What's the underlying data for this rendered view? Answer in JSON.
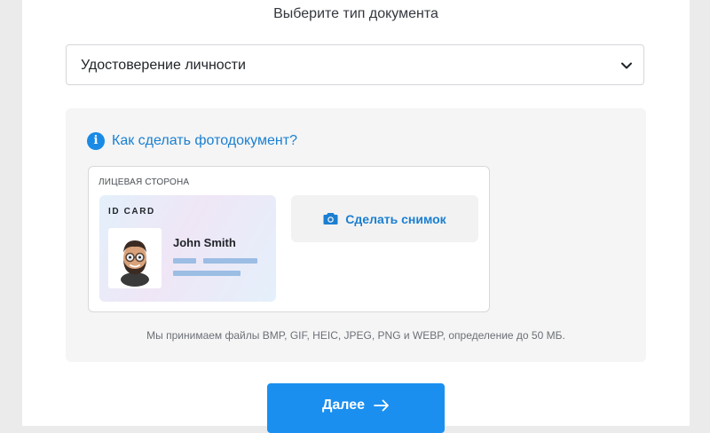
{
  "heading": "Выберите тип документа",
  "document_select": {
    "selected": "Удостоверение личности",
    "icon": "chevron-down-icon"
  },
  "instructions": {
    "how_to_label": "Как сделать фотодокумент?",
    "icon": "info-icon",
    "side_label": "ЛИЦЕВАЯ СТОРОНА",
    "sample_card": {
      "title": "ID CARD",
      "name": "John Smith"
    },
    "capture_button": {
      "label": "Сделать снимок",
      "icon": "camera-icon"
    },
    "note": "Мы принимаем файлы BMP, GIF, HEIC, JPEG, PNG и WEBP, определение до 50 МБ."
  },
  "next_button": {
    "label": "Далее",
    "icon": "arrow-right-icon"
  },
  "colors": {
    "accent": "#1a8ff0",
    "link": "#1a7fd1",
    "panel_bg": "#f5f5f5",
    "outer_bg": "#ebebeb"
  }
}
